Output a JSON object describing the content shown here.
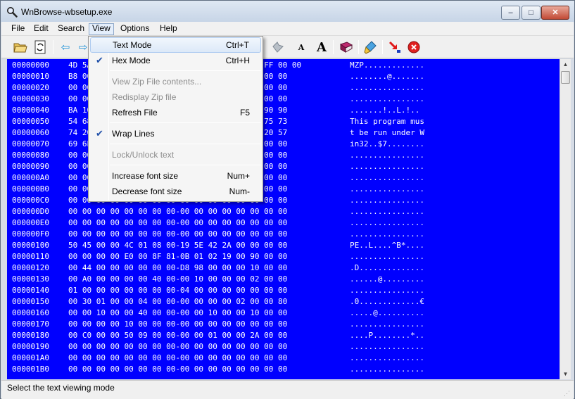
{
  "window": {
    "title": "WnBrowse-wbsetup.exe",
    "min_label": "–",
    "max_label": "□",
    "close_label": "✕"
  },
  "menubar": {
    "items": [
      "File",
      "Edit",
      "Search",
      "View",
      "Options",
      "Help"
    ],
    "open": "View"
  },
  "toolbar": {
    "icons": [
      "open-folder-icon",
      "refresh-file-icon",
      "back-arrow-icon",
      "forward-arrow-icon",
      "bookmark-icon",
      "print-icon",
      "smaller-font-icon",
      "larger-font-icon",
      "book-icon",
      "brush-icon",
      "jump-icon",
      "stop-icon"
    ],
    "font_small_label": "A",
    "font_large_label": "A"
  },
  "view_menu": {
    "items": [
      {
        "label": "Text Mode",
        "shortcut": "Ctrl+T",
        "checked": false,
        "disabled": false
      },
      {
        "label": "Hex Mode",
        "shortcut": "Ctrl+H",
        "checked": true,
        "disabled": false
      },
      {
        "label": "View Zip File contents...",
        "shortcut": "",
        "checked": false,
        "disabled": true
      },
      {
        "label": "Redisplay Zip file",
        "shortcut": "",
        "checked": false,
        "disabled": true
      },
      {
        "label": "Refresh File",
        "shortcut": "F5",
        "checked": false,
        "disabled": false
      },
      {
        "label": "Wrap Lines",
        "shortcut": "",
        "checked": true,
        "disabled": false
      },
      {
        "label": "Lock/Unlock text",
        "shortcut": "",
        "checked": false,
        "disabled": true
      },
      {
        "label": "Increase font size",
        "shortcut": "Num+",
        "checked": false,
        "disabled": false
      },
      {
        "label": "Decrease font size",
        "shortcut": "Num-",
        "checked": false,
        "disabled": false
      }
    ],
    "check_mark": "✔"
  },
  "hex_view": {
    "rows": [
      {
        "offset": "00000000",
        "hex": "4D 5A 90 00 03 00 00 00 00-04 00 00 00 FF FF 00 00",
        "ascii": "MZP............."
      },
      {
        "offset": "00000010",
        "hex": "B8 00 00 00 00 00 00 00-40 00 1A 00 00 00 00 00",
        "ascii": "........@......."
      },
      {
        "offset": "00000020",
        "hex": "00 00 00 00 00 00 00 00-00 00 00 00 00 00 00 00",
        "ascii": "................"
      },
      {
        "offset": "00000030",
        "hex": "00 00 00 00 00 00 00 00-00 00 00 00 00 01 00 00",
        "ascii": "................"
      },
      {
        "offset": "00000040",
        "hex": "BA 10 00 0E 1F B4 09 CD-21 B8 01 4C CD 21 90 90",
        "ascii": ".......!..L.!.."
      },
      {
        "offset": "00000050",
        "hex": "54 68 69 73 20 70 72 6F-67 72 61 6D 20 6D 75 73",
        "ascii": "This program mus"
      },
      {
        "offset": "00000060",
        "hex": "74 20 62 65 20 72 75 6E-20 75 6E 64 65 72 20 57",
        "ascii": "t be run under W"
      },
      {
        "offset": "00000070",
        "hex": "69 6E 33 32 0D 0A 24 37-00 00 00 00 00 00 00 00",
        "ascii": "in32..$7........"
      },
      {
        "offset": "00000080",
        "hex": "00 00 00 00 00 00 00 00-00 00 00 00 00 00 00 00",
        "ascii": "................"
      },
      {
        "offset": "00000090",
        "hex": "00 00 00 00 00 00 00 00-00 00 00 00 00 00 00 00",
        "ascii": "................"
      },
      {
        "offset": "000000A0",
        "hex": "00 00 00 00 00 00 00 00-00 00 00 00 00 00 00 00",
        "ascii": "................"
      },
      {
        "offset": "000000B0",
        "hex": "00 00 00 00 00 00 00 00-00 00 00 00 00 00 00 00",
        "ascii": "................"
      },
      {
        "offset": "000000C0",
        "hex": "00 00 00 00 00 00 00 00-00 00 00 00 00 00 00 00",
        "ascii": "................"
      },
      {
        "offset": "000000D0",
        "hex": "00 00 00 00 00 00 00 00-00 00 00 00 00 00 00 00",
        "ascii": "................"
      },
      {
        "offset": "000000E0",
        "hex": "00 00 00 00 00 00 00 00-00 00 00 00 00 00 00 00",
        "ascii": "................"
      },
      {
        "offset": "000000F0",
        "hex": "00 00 00 00 00 00 00 00-00 00 00 00 00 00 00 00",
        "ascii": "................"
      },
      {
        "offset": "00000100",
        "hex": "50 45 00 00 4C 01 08 00-19 5E 42 2A 00 00 00 00",
        "ascii": "PE..L....^B*...."
      },
      {
        "offset": "00000110",
        "hex": "00 00 00 00 E0 00 8F 81-0B 01 02 19 00 90 00 00",
        "ascii": "................"
      },
      {
        "offset": "00000120",
        "hex": "00 44 00 00 00 00 00 00-D8 98 00 00 00 10 00 00",
        "ascii": ".D.............."
      },
      {
        "offset": "00000130",
        "hex": "00 A0 00 00 00 00 40 00-00 10 00 00 00 02 00 00",
        "ascii": "......@........."
      },
      {
        "offset": "00000140",
        "hex": "01 00 00 00 00 00 00 00-04 00 00 00 00 00 00 00",
        "ascii": "................"
      },
      {
        "offset": "00000150",
        "hex": "00 30 01 00 00 04 00 00-00 00 00 00 02 00 00 80",
        "ascii": ".0.............€"
      },
      {
        "offset": "00000160",
        "hex": "00 00 10 00 00 40 00 00-00 00 10 00 00 10 00 00",
        "ascii": ".....@.........."
      },
      {
        "offset": "00000170",
        "hex": "00 00 00 00 10 00 00 00-00 00 00 00 00 00 00 00",
        "ascii": "................"
      },
      {
        "offset": "00000180",
        "hex": "00 C0 00 00 50 09 00 00-00 00 01 00 00 2A 00 00",
        "ascii": "....P........*.."
      },
      {
        "offset": "00000190",
        "hex": "00 00 00 00 00 00 00 00-00 00 00 00 00 00 00 00",
        "ascii": "................"
      },
      {
        "offset": "000001A0",
        "hex": "00 00 00 00 00 00 00 00-00 00 00 00 00 00 00 00",
        "ascii": "................"
      },
      {
        "offset": "000001B0",
        "hex": "00 00 00 00 00 00 00 00-00 00 00 00 00 00 00 00",
        "ascii": "................"
      }
    ]
  },
  "scrollbar": {
    "up_label": "▲",
    "down_label": "▼"
  },
  "status": {
    "text": "Select the text viewing mode",
    "grip": "⋰"
  },
  "colors": {
    "hex_background": "#0000ff",
    "hex_text": "#ffffff"
  }
}
